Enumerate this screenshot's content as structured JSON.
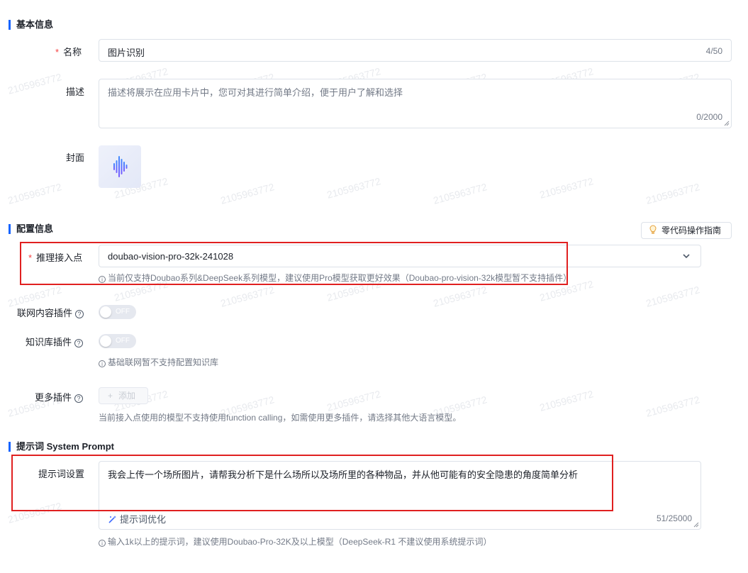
{
  "watermark": "2105963772",
  "sections": {
    "basic": "基本信息",
    "config": "配置信息",
    "prompt": "提示词 System Prompt"
  },
  "basic": {
    "name_label": "名称",
    "name_value": "图片识别",
    "name_counter": "4/50",
    "desc_label": "描述",
    "desc_placeholder": "描述将展示在应用卡片中，您可对其进行简单介绍，便于用户了解和选择",
    "desc_counter": "0/2000",
    "cover_label": "封面"
  },
  "config": {
    "guide_button": "零代码操作指南",
    "endpoint_label": "推理接入点",
    "endpoint_value": "doubao-vision-pro-32k-241028",
    "endpoint_hint": "当前仅支持Doubao系列&DeepSeek系列模型，建议使用Pro模型获取更好效果（Doubao-pro-vision-32k模型暂不支持插件）",
    "web_plugin_label": "联网内容插件",
    "web_plugin_toggle": "OFF",
    "kb_plugin_label": "知识库插件",
    "kb_plugin_toggle": "OFF",
    "kb_hint": "基础联网暂不支持配置知识库",
    "more_plugins_label": "更多插件",
    "add_button": "添加",
    "more_hint": "当前接入点使用的模型不支持使用function calling，如需使用更多插件，请选择其他大语言模型。"
  },
  "prompt": {
    "setting_label": "提示词设置",
    "value": "我会上传一个场所图片，请帮我分析下是什么场所以及场所里的各种物品，并从他可能有的安全隐患的角度简单分析",
    "optimize_button": "提示词优化",
    "counter": "51/25000",
    "hint": "输入1k以上的提示词，建议使用Doubao-Pro-32K及以上模型（DeepSeek-R1 不建议使用系统提示词）"
  },
  "colors": {
    "accent": "#1664ff",
    "required": "#f53f3f",
    "highlight_box": "#e02020"
  }
}
